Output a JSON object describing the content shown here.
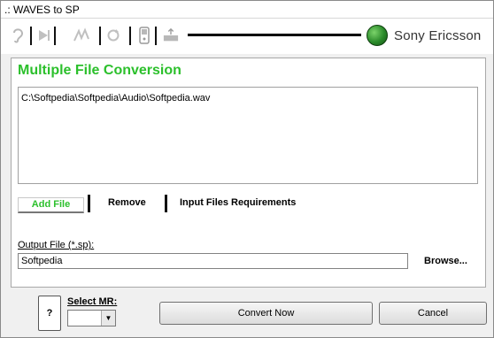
{
  "window": {
    "title": ".: WAVES to SP"
  },
  "toolbar": {
    "icons": [
      "ear-icon",
      "play-icon",
      "wave-icon",
      "refresh-icon",
      "device-icon",
      "export-icon"
    ],
    "brand": "Sony Ericsson",
    "accent_color": "#2cc02c"
  },
  "panel": {
    "title": "Multiple File Conversion",
    "files": [
      "C:\\Softpedia\\Softpedia\\Audio\\Softpedia.wav"
    ],
    "add_file_label": "Add File",
    "remove_label": "Remove",
    "requirements_label": "Input Files Requirements",
    "output_label": "Output File (*.sp):",
    "output_value": "Softpedia",
    "browse_label": "Browse..."
  },
  "footer": {
    "help_label": "?",
    "select_mr_label": "Select MR:",
    "select_mr_value": "",
    "convert_label": "Convert Now",
    "cancel_label": "Cancel"
  }
}
